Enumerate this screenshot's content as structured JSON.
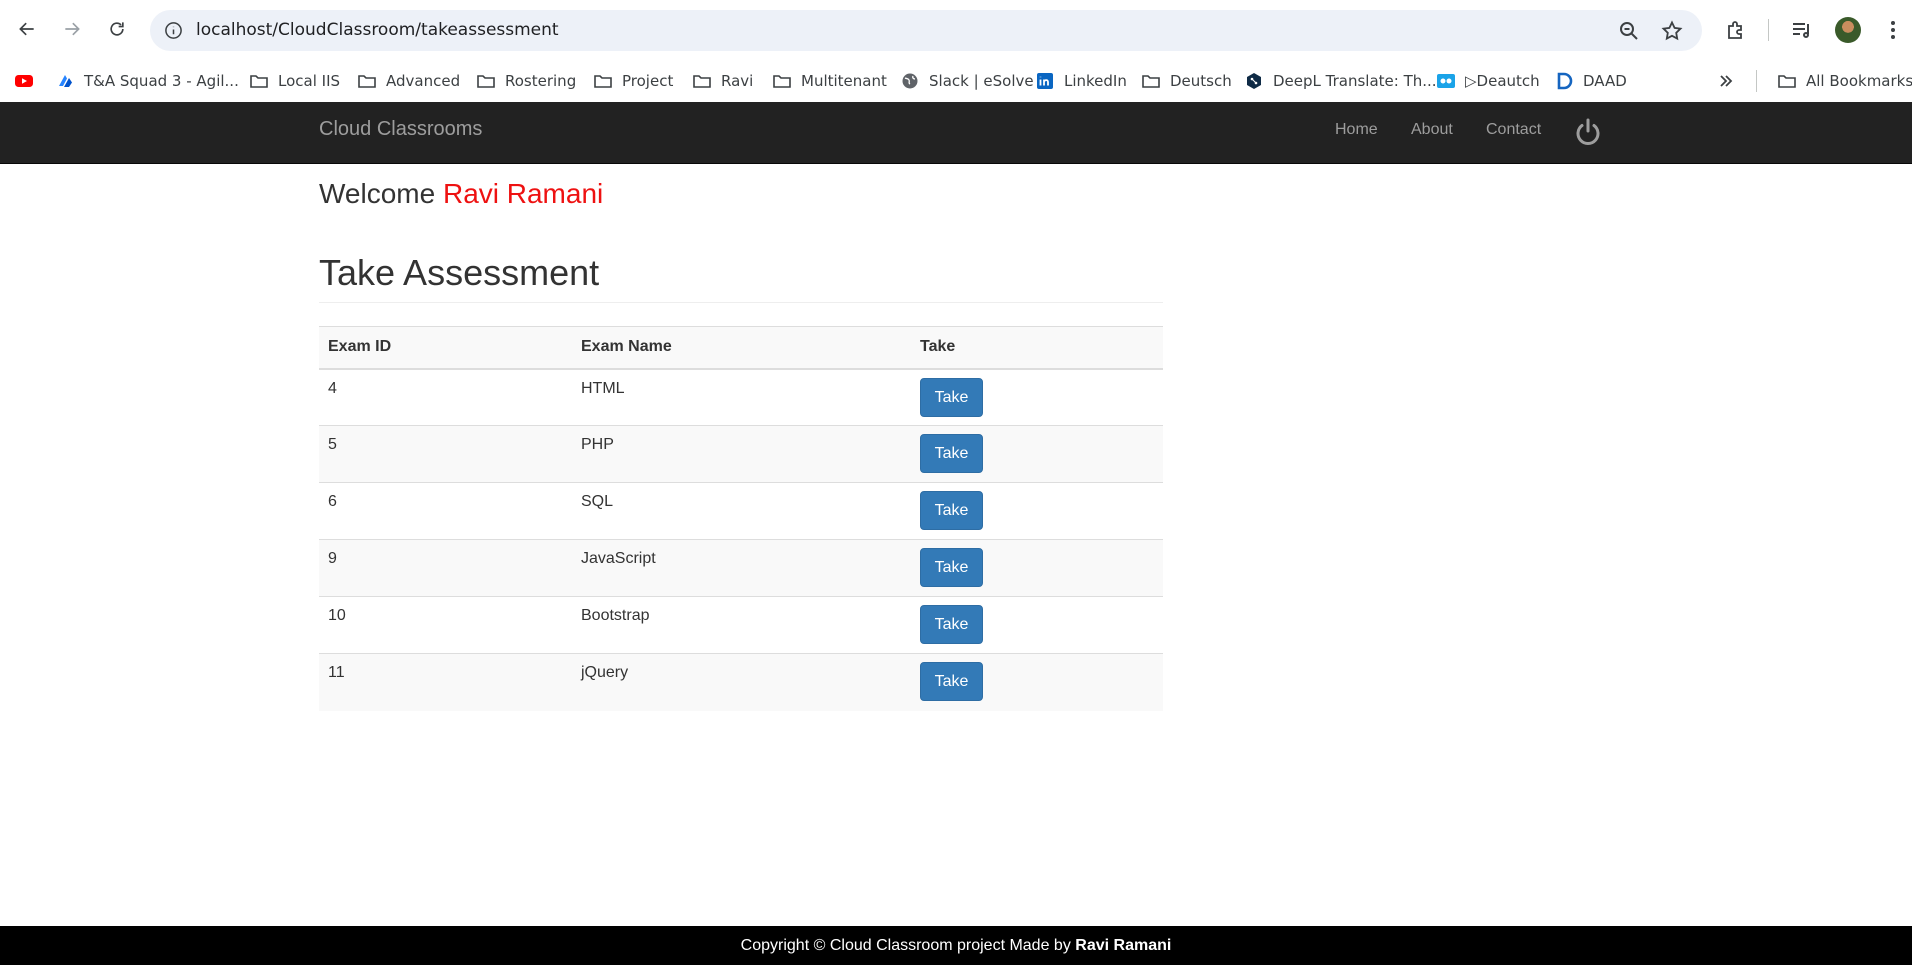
{
  "browser": {
    "url": "localhost/CloudClassroom/takeassessment",
    "bookmarks": [
      {
        "label": "",
        "icon": "youtube-icon"
      },
      {
        "label": "T&A Squad 3 - Agil...",
        "icon": "jira-icon"
      },
      {
        "label": "Local IIS",
        "icon": "folder-icon"
      },
      {
        "label": "Advanced",
        "icon": "folder-icon"
      },
      {
        "label": "Rostering",
        "icon": "folder-icon"
      },
      {
        "label": "Project",
        "icon": "folder-icon"
      },
      {
        "label": "Ravi",
        "icon": "folder-icon"
      },
      {
        "label": "Multitenant",
        "icon": "folder-icon"
      },
      {
        "label": "Slack | eSolve",
        "icon": "globe-icon"
      },
      {
        "label": "LinkedIn",
        "icon": "linkedin-icon"
      },
      {
        "label": "Deutsch",
        "icon": "folder-icon"
      },
      {
        "label": "DeepL Translate: Th...",
        "icon": "deepl-icon"
      },
      {
        "label": "▷Deautch",
        "icon": "deautch-icon"
      },
      {
        "label": "DAAD",
        "icon": "daad-icon"
      }
    ],
    "all_bookmarks": "All Bookmarks"
  },
  "navbar": {
    "brand": "Cloud Classrooms",
    "links": [
      "Home",
      "About",
      "Contact"
    ]
  },
  "welcome": {
    "prefix": "Welcome",
    "user": "Ravi Ramani"
  },
  "page": {
    "title": "Take Assessment"
  },
  "table": {
    "headers": [
      "Exam ID",
      "Exam Name",
      "Take"
    ],
    "rows": [
      {
        "id": "4",
        "name": "HTML",
        "action": "Take"
      },
      {
        "id": "5",
        "name": "PHP",
        "action": "Take"
      },
      {
        "id": "6",
        "name": "SQL",
        "action": "Take"
      },
      {
        "id": "9",
        "name": "JavaScript",
        "action": "Take"
      },
      {
        "id": "10",
        "name": "Bootstrap",
        "action": "Take"
      },
      {
        "id": "11",
        "name": "jQuery",
        "action": "Take"
      }
    ]
  },
  "footer": {
    "text": "Copyright © Cloud Classroom project Made by",
    "author": "Ravi Ramani"
  },
  "colors": {
    "navbar_bg": "#222222",
    "brand_text": "#9d9d9d",
    "username": "#ee1111",
    "button_primary": "#337ab7",
    "footer_bg": "#000000"
  }
}
